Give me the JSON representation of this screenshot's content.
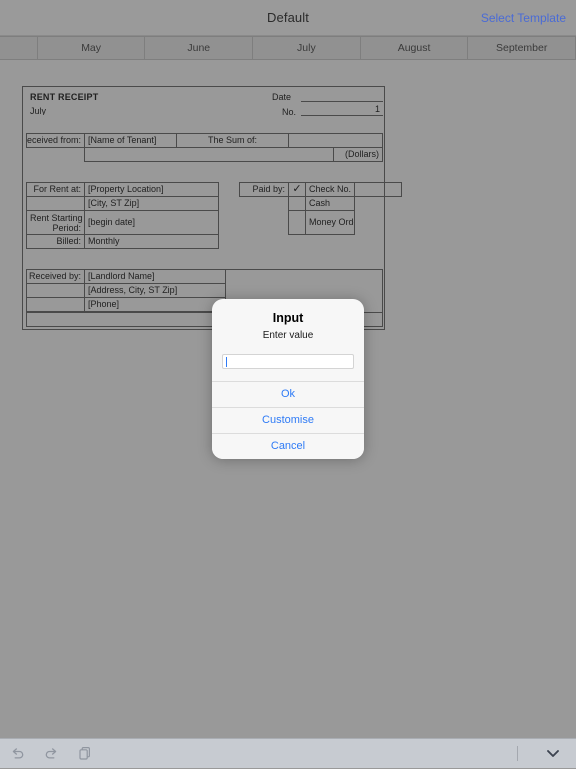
{
  "navbar": {
    "title": "Default",
    "right_action": "Select Template"
  },
  "tabs": {
    "corner_label": "",
    "months": [
      "May",
      "June",
      "July",
      "August",
      "September"
    ]
  },
  "receipt": {
    "heading": "RENT RECEIPT",
    "month": "July",
    "date_label": "Date",
    "date_value": "",
    "no_label": "No.",
    "no_value": "1",
    "received_from_label": "Received from:",
    "tenant_name": "[Name of Tenant]",
    "sum_of_label": "The Sum of:",
    "sum_value": "",
    "amount_value": "",
    "dollars_label": "(Dollars)",
    "for_rent_at_label": "For Rent at:",
    "property_location": "[Property Location]",
    "city_state_zip": "[City, ST  Zip]",
    "rent_starting_label_line1": "Rent Starting",
    "rent_starting_label_line2": "Period:",
    "begin_date": "[begin date]",
    "billed_label": "Billed:",
    "billed_value": "Monthly",
    "paid_by_label": "Paid by:",
    "paid_by_check_mark": "✓",
    "paid_check_no_label": "Check No.",
    "paid_check_no_value": "",
    "paid_cash_label": "Cash",
    "paid_money_order_label": "Money Order",
    "received_by_label": "Received by:",
    "landlord_name": "[Landlord Name]",
    "landlord_address": "[Address, City, ST  Zip]",
    "landlord_phone": "[Phone]"
  },
  "alert": {
    "title": "Input",
    "message": "Enter value",
    "input_value": "",
    "input_placeholder": "",
    "buttons": [
      "Ok",
      "Customise",
      "Cancel"
    ]
  },
  "toolbar": {
    "undo_icon": "undo-arrow-icon",
    "redo_icon": "redo-arrow-icon",
    "copy_icon": "copy-icon",
    "collapse_icon": "chevron-down-icon"
  },
  "colors": {
    "accent_blue": "#2f7bf6",
    "link_blue": "#4a6bd6",
    "page_background": "#999999",
    "toolbar_background": "#c7cbd1"
  }
}
